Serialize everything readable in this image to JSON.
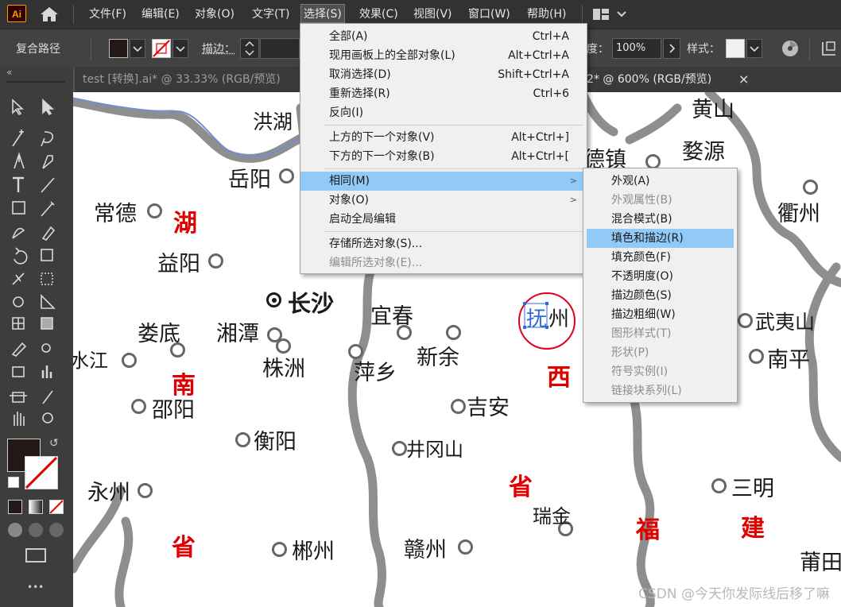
{
  "app": {
    "logo_text": "Ai",
    "home_icon": "home-icon",
    "workspace_icon": "workspace-switcher-icon"
  },
  "menubar": {
    "items": [
      "文件(F)",
      "编辑(E)",
      "对象(O)",
      "文字(T)",
      "选择(S)",
      "效果(C)",
      "视图(V)",
      "窗口(W)",
      "帮助(H)"
    ],
    "active": "选择(S)"
  },
  "controlbar": {
    "object_type": "复合路径",
    "stroke_label": "描边：",
    "opacity_label": "度：",
    "opacity_value": "100%",
    "style_label": "样式："
  },
  "tabs": [
    {
      "label": "test [转换].ai* @ 33.33% (RGB/预览)"
    },
    {
      "label": "-2* @ 600% (RGB/预览)",
      "close": "×"
    }
  ],
  "toolbar": {
    "collapse": "«",
    "more": "•••"
  },
  "select_menu": {
    "items": [
      {
        "label": "全部(A)",
        "shortcut": "Ctrl+A"
      },
      {
        "label": "现用画板上的全部对象(L)",
        "shortcut": "Alt+Ctrl+A"
      },
      {
        "label": "取消选择(D)",
        "shortcut": "Shift+Ctrl+A"
      },
      {
        "label": "重新选择(R)",
        "shortcut": "Ctrl+6"
      },
      {
        "label": "反向(I)",
        "shortcut": ""
      },
      {
        "label": "上方的下一个对象(V)",
        "shortcut": "Alt+Ctrl+]"
      },
      {
        "label": "下方的下一个对象(B)",
        "shortcut": "Alt+Ctrl+["
      },
      {
        "label": "相同(M)",
        "shortcut": "",
        "submenu": true,
        "highlighted": true
      },
      {
        "label": "对象(O)",
        "shortcut": "",
        "submenu": true
      },
      {
        "label": "启动全局编辑",
        "shortcut": ""
      },
      {
        "label": "存储所选对象(S)...",
        "shortcut": ""
      },
      {
        "label": "编辑所选对象(E)...",
        "shortcut": "",
        "disabled": true
      }
    ]
  },
  "same_submenu": {
    "items": [
      {
        "label": "外观(A)"
      },
      {
        "label": "外观属性(B)",
        "disabled": true
      },
      {
        "label": "混合模式(B)"
      },
      {
        "label": "填色和描边(R)",
        "highlighted": true
      },
      {
        "label": "填充颜色(F)"
      },
      {
        "label": "不透明度(O)"
      },
      {
        "label": "描边颜色(S)"
      },
      {
        "label": "描边粗细(W)"
      },
      {
        "label": "图形样式(T)",
        "disabled": true
      },
      {
        "label": "形状(P)",
        "disabled": true
      },
      {
        "label": "符号实例(I)",
        "disabled": true
      },
      {
        "label": "链接块系列(L)",
        "disabled": true
      }
    ]
  },
  "map": {
    "cities": [
      "洪湖",
      "岳阳",
      "常德",
      "益阳",
      "长沙",
      "娄底",
      "湘潭",
      "株洲",
      "宜春",
      "新余",
      "萍乡",
      "吉安",
      "井冈山",
      "邵阳",
      "衡阳",
      "永州",
      "郴州",
      "赣州",
      "瑞金",
      "水江",
      "抚",
      "州",
      "黄山",
      "婺源",
      "德镇",
      "衢州",
      "武夷山",
      "南平",
      "三明",
      "莆田"
    ],
    "provinces": [
      "湖",
      "南",
      "省",
      "西",
      "省",
      "福",
      "建"
    ]
  },
  "watermark": "CSDN @今天你发际线后移了嘛",
  "colors": {
    "accent_select": "#91c9f7",
    "province_red": "#e00000",
    "selection_blue": "#2f6bd8"
  }
}
